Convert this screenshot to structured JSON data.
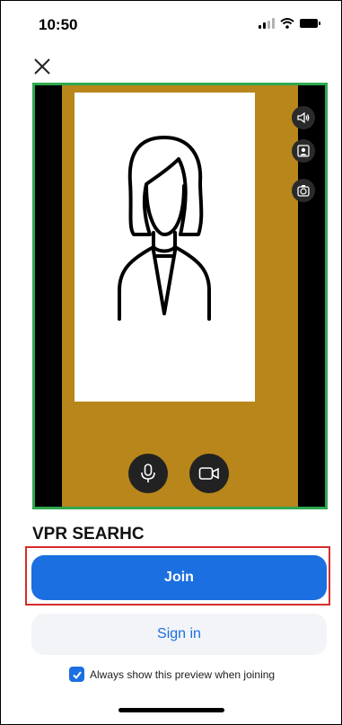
{
  "status_bar": {
    "time": "10:50"
  },
  "meeting": {
    "name": "VPR SEARHC"
  },
  "actions": {
    "join_label": "Join",
    "sign_in_label": "Sign in"
  },
  "preview_toggle": {
    "label": "Always show this preview when joining",
    "checked": true
  },
  "colors": {
    "accent": "#1b6fe0",
    "preview_bg": "#b8861b",
    "highlight_border": "#d52d2d",
    "preview_border": "#2fa84f"
  },
  "icons": {
    "close": "close-icon",
    "speaker": "speaker-icon",
    "portrait": "portrait-icon",
    "switch_camera": "switch-camera-icon",
    "microphone": "microphone-icon",
    "camera": "camera-icon",
    "avatar": "avatar-icon",
    "check": "check-icon"
  }
}
